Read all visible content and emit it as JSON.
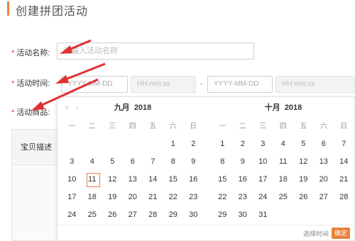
{
  "header": {
    "title": "创建拼团活动"
  },
  "form": {
    "required_mark": "*",
    "name_label": "活动名称:",
    "name_placeholder": "请输入活动名称",
    "time_label": "活动时间:",
    "start_date_placeholder": "YYYY-MM-DD",
    "start_time_placeholder": "HH:mm:ss",
    "range_separator": "-",
    "end_date_placeholder": "YYYY-MM-DD",
    "end_time_placeholder": "HH:mm:ss",
    "product_label": "活动商品:"
  },
  "product_table": {
    "header": "宝贝描述"
  },
  "date_picker": {
    "nav": {
      "prev_year": "«",
      "prev_month": "‹",
      "next_month": "›",
      "next_year": "»"
    },
    "weekdays": [
      "一",
      "二",
      "三",
      "四",
      "五",
      "六",
      "日"
    ],
    "months": [
      {
        "month_label": "九月",
        "year_label": "2018",
        "today": "11",
        "weeks": [
          [
            "",
            "",
            "",
            "",
            "",
            "1",
            "2"
          ],
          [
            "3",
            "4",
            "5",
            "6",
            "7",
            "8",
            "9"
          ],
          [
            "10",
            "11",
            "12",
            "13",
            "14",
            "15",
            "16"
          ],
          [
            "17",
            "18",
            "19",
            "20",
            "21",
            "22",
            "23"
          ],
          [
            "24",
            "25",
            "26",
            "27",
            "28",
            "29",
            "30"
          ]
        ]
      },
      {
        "month_label": "十月",
        "year_label": "2018",
        "weeks": [
          [
            "1",
            "2",
            "3",
            "4",
            "5",
            "6",
            "7"
          ],
          [
            "8",
            "9",
            "10",
            "11",
            "12",
            "13",
            "14"
          ],
          [
            "15",
            "16",
            "17",
            "18",
            "19",
            "20",
            "21"
          ],
          [
            "22",
            "23",
            "24",
            "25",
            "26",
            "27",
            "28"
          ],
          [
            "29",
            "30",
            "31",
            "",
            "",
            "",
            ""
          ]
        ]
      }
    ],
    "footer": {
      "select_time_label": "选择时间",
      "confirm_label": "确定"
    }
  },
  "colors": {
    "accent": "#e8833a",
    "required": "#e4393c",
    "arrow": "#e03030"
  }
}
